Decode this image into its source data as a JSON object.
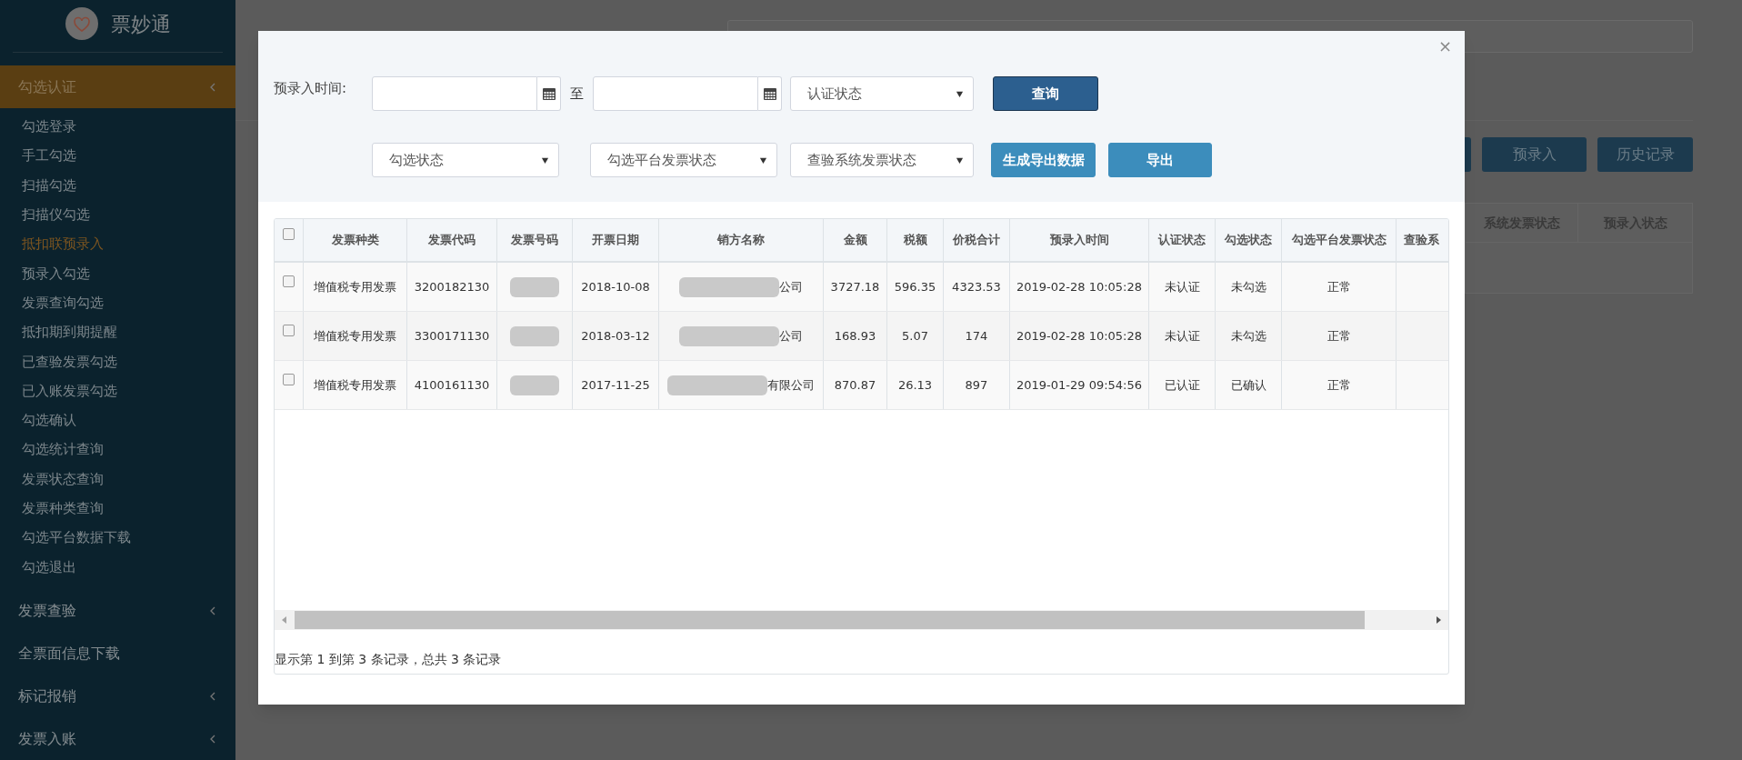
{
  "sidebar": {
    "logo_text": "票妙通",
    "menu": [
      {
        "label": "勾选认证",
        "kind": "group",
        "expanded": true,
        "children": [
          {
            "label": "勾选登录",
            "selected": false
          },
          {
            "label": "手工勾选",
            "selected": false
          },
          {
            "label": "扫描勾选",
            "selected": false
          },
          {
            "label": "扫描仪勾选",
            "selected": false
          },
          {
            "label": "抵扣联预录入",
            "selected": true
          },
          {
            "label": "预录入勾选",
            "selected": false
          },
          {
            "label": "发票查询勾选",
            "selected": false
          },
          {
            "label": "抵扣期到期提醒",
            "selected": false
          },
          {
            "label": "已查验发票勾选",
            "selected": false
          },
          {
            "label": "已入账发票勾选",
            "selected": false
          },
          {
            "label": "勾选确认",
            "selected": false
          },
          {
            "label": "勾选统计查询",
            "selected": false
          },
          {
            "label": "发票状态查询",
            "selected": false
          },
          {
            "label": "发票种类查询",
            "selected": false
          },
          {
            "label": "勾选平台数据下载",
            "selected": false
          },
          {
            "label": "勾选退出",
            "selected": false
          }
        ]
      },
      {
        "label": "发票查验",
        "kind": "group",
        "expanded": false
      },
      {
        "label": "全票面信息下载",
        "kind": "link"
      },
      {
        "label": "标记报销",
        "kind": "group",
        "expanded": false
      },
      {
        "label": "发票入账",
        "kind": "group",
        "expanded": false
      }
    ]
  },
  "page": {
    "buttons": [
      "预录入",
      "历史记录"
    ],
    "table": {
      "columns": [
        "系统发票状态",
        "预录入状态"
      ]
    }
  },
  "dialog": {
    "close": "×",
    "filters": {
      "date_label": "预录入时间:",
      "range_separator": "至",
      "row_1_selects": [
        "认证状态"
      ],
      "row_2_selects": [
        "勾选状态",
        "勾选平台发票状态",
        "查验系统发票状态"
      ]
    },
    "buttons": [
      {
        "label": "查询",
        "kind": "dark"
      },
      {
        "label": "生成导出数据",
        "kind": "light"
      },
      {
        "label": "导出",
        "kind": "light"
      }
    ],
    "table": {
      "header_checked": false,
      "columns": [
        "发票种类",
        "发票代码",
        "发票号码",
        "开票日期",
        "销方名称",
        "金额",
        "税额",
        "价税合计",
        "预录入时间",
        "认证状态",
        "勾选状态",
        "勾选平台发票状态",
        "查验系"
      ],
      "rows": [
        {
          "checked": false,
          "cells": [
            {
              "text": "增值税专用发票"
            },
            {
              "text": "3200182130"
            },
            {
              "redacted": true
            },
            {
              "text": "2018-10-08"
            },
            {
              "text": "公司",
              "redacted": true
            },
            {
              "text": "3727.18"
            },
            {
              "text": "596.35"
            },
            {
              "text": "4323.53"
            },
            {
              "text": "2019-02-28 10:05:28"
            },
            {
              "text": "未认证"
            },
            {
              "text": "未勾选"
            },
            {
              "text": "正常"
            }
          ]
        },
        {
          "checked": false,
          "cells": [
            {
              "text": "增值税专用发票"
            },
            {
              "text": "3300171130"
            },
            {
              "redacted": true
            },
            {
              "text": "2018-03-12"
            },
            {
              "text": "公司",
              "redacted": true
            },
            {
              "text": "168.93"
            },
            {
              "text": "5.07"
            },
            {
              "text": "174"
            },
            {
              "text": "2019-02-28 10:05:28"
            },
            {
              "text": "未认证"
            },
            {
              "text": "未勾选"
            },
            {
              "text": "正常"
            }
          ]
        },
        {
          "checked": false,
          "cells": [
            {
              "text": "增值税专用发票"
            },
            {
              "text": "4100161130"
            },
            {
              "redacted": true
            },
            {
              "text": "2017-11-25"
            },
            {
              "text": "有限公司",
              "redacted": true
            },
            {
              "text": "870.87"
            },
            {
              "text": "26.13"
            },
            {
              "text": "897"
            },
            {
              "text": "2019-01-29 09:54:56"
            },
            {
              "text": "已认证"
            },
            {
              "text": "已确认"
            },
            {
              "text": "正常"
            }
          ]
        }
      ],
      "footer": "显示第 1 到第 3 条记录，总共 3 条记录"
    }
  }
}
